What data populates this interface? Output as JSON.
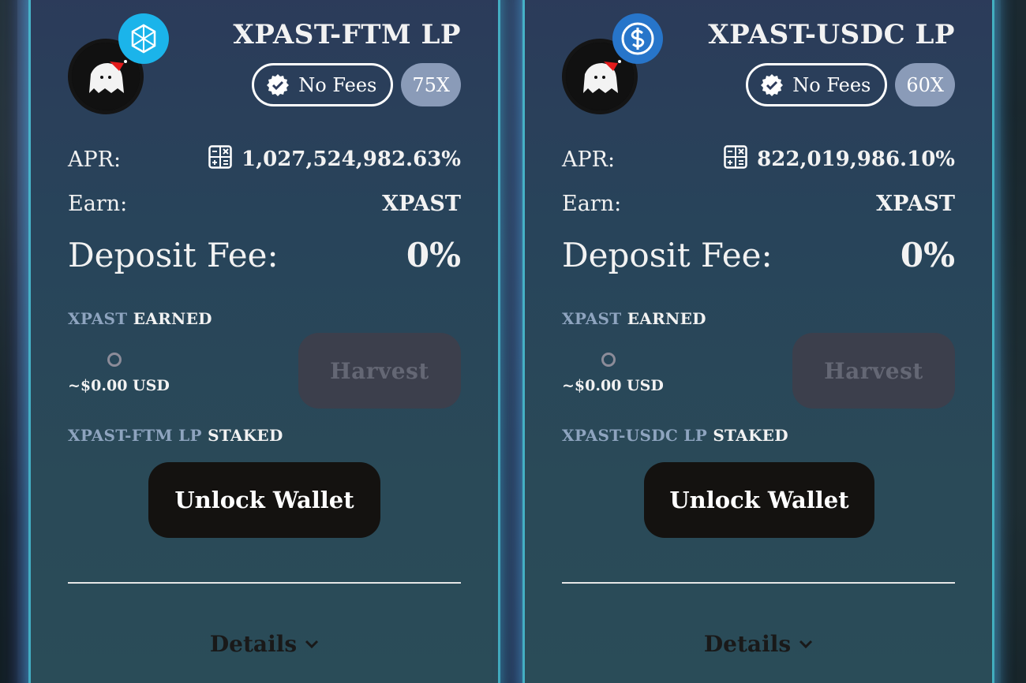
{
  "colors": {
    "card_glow": "#40d8e6",
    "ftm_blue": "#1bb4ea",
    "usdc_blue": "#2775ca",
    "multiplier_bg": "#8a9bb8",
    "muted_token": "#8ea4bf",
    "harvest_disabled": "#3c3f4c",
    "unlock_bg": "#141210"
  },
  "farms": [
    {
      "title": "XPAST-FTM LP",
      "token_icon": "fantom-icon",
      "no_fees_label": "No Fees",
      "multiplier": "75X",
      "apr_label": "APR:",
      "apr_value": "1,027,524,982.63%",
      "earn_label": "Earn:",
      "earn_value": "XPAST",
      "deposit_fee_label": "Deposit Fee:",
      "deposit_fee_value": "0%",
      "earned_token": "XPAST",
      "earned_suffix": "EARNED",
      "earned_usd": "~$0.00 USD",
      "harvest_label": "Harvest",
      "staked_token": "XPAST-FTM LP",
      "staked_suffix": "STAKED",
      "unlock_label": "Unlock Wallet",
      "details_label": "Details"
    },
    {
      "title": "XPAST-USDC LP",
      "token_icon": "usdc-icon",
      "no_fees_label": "No Fees",
      "multiplier": "60X",
      "apr_label": "APR:",
      "apr_value": "822,019,986.10%",
      "earn_label": "Earn:",
      "earn_value": "XPAST",
      "deposit_fee_label": "Deposit Fee:",
      "deposit_fee_value": "0%",
      "earned_token": "XPAST",
      "earned_suffix": "EARNED",
      "earned_usd": "~$0.00 USD",
      "harvest_label": "Harvest",
      "staked_token": "XPAST-USDC LP",
      "staked_suffix": "STAKED",
      "unlock_label": "Unlock Wallet",
      "details_label": "Details"
    }
  ]
}
